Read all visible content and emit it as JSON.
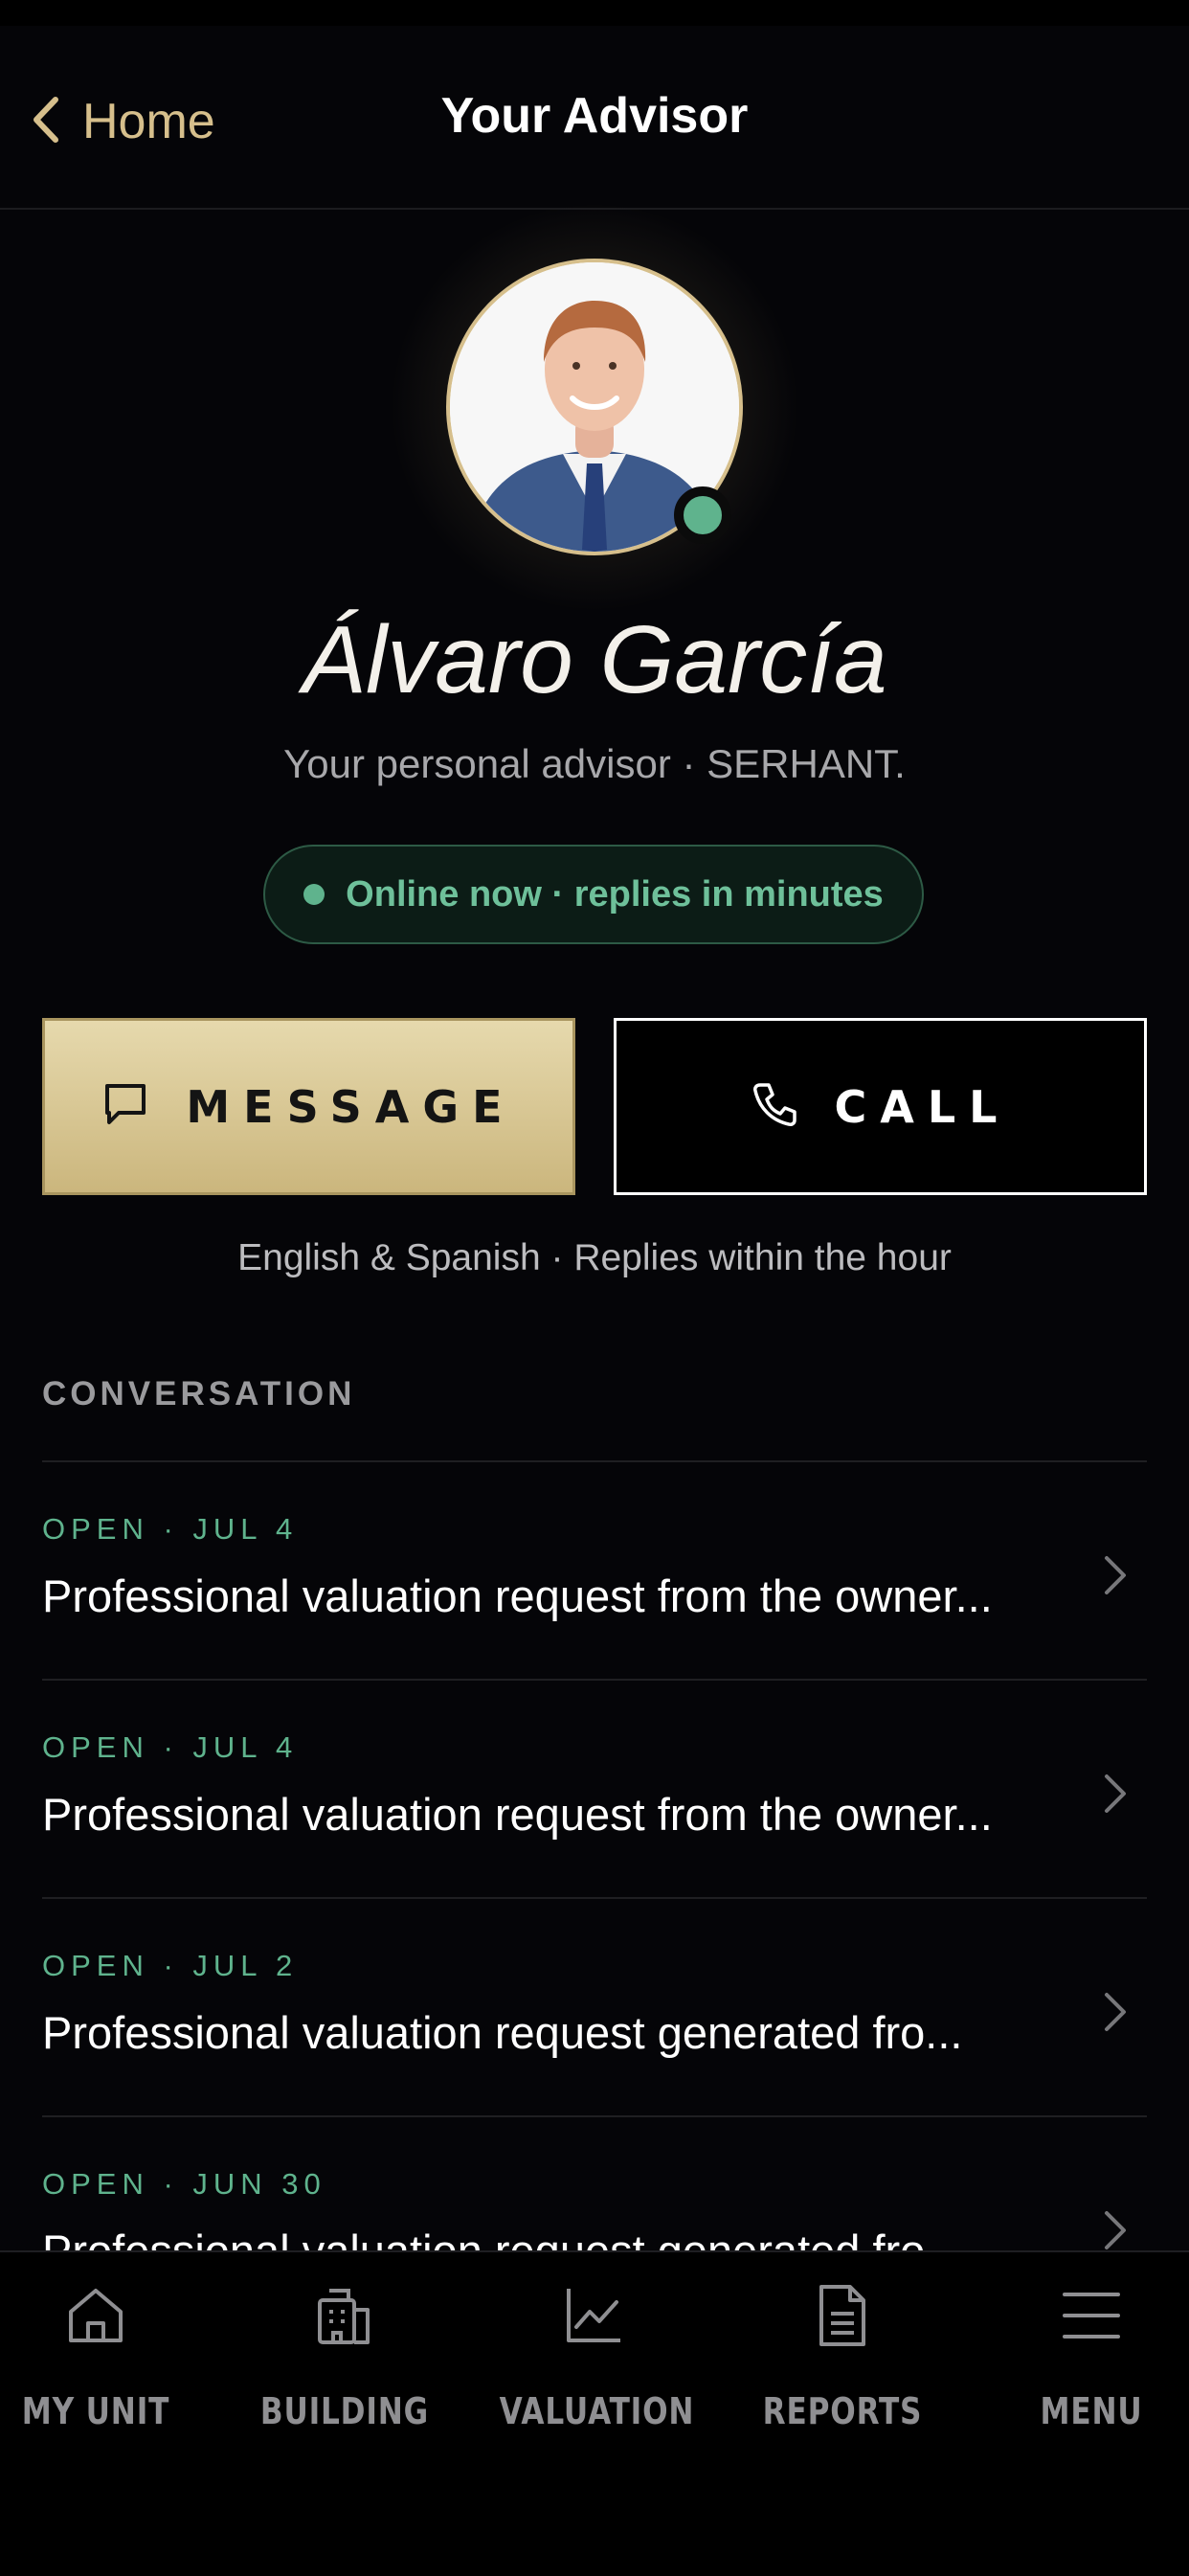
{
  "header": {
    "back_label": "Home",
    "title": "Your Advisor"
  },
  "advisor": {
    "name": "Álvaro García",
    "subtitle": "Your personal advisor · SERHANT.",
    "status": "Online now · replies in minutes",
    "status_color": "#5fb38d"
  },
  "actions": {
    "message_label": "MESSAGE",
    "call_label": "CALL",
    "note": "English & Spanish · Replies within the hour"
  },
  "conversation": {
    "section_label": "CONVERSATION",
    "items": [
      {
        "meta": "OPEN · JUL 4",
        "title": "Professional valuation request from the owner..."
      },
      {
        "meta": "OPEN · JUL 4",
        "title": "Professional valuation request from the owner..."
      },
      {
        "meta": "OPEN · JUL 2",
        "title": "Professional valuation request generated fro..."
      },
      {
        "meta": "OPEN · JUN 30",
        "title": "Professional valuation request generated fro..."
      }
    ]
  },
  "nav": {
    "items": [
      {
        "label": "MY UNIT",
        "icon": "home-icon"
      },
      {
        "label": "BUILDING",
        "icon": "building-icon"
      },
      {
        "label": "VALUATION",
        "icon": "chart-icon"
      },
      {
        "label": "REPORTS",
        "icon": "document-icon"
      },
      {
        "label": "MENU",
        "icon": "menu-icon"
      }
    ]
  },
  "colors": {
    "accent_gold": "#d6bf8c",
    "online_green": "#5fb38d",
    "background": "#050508"
  }
}
